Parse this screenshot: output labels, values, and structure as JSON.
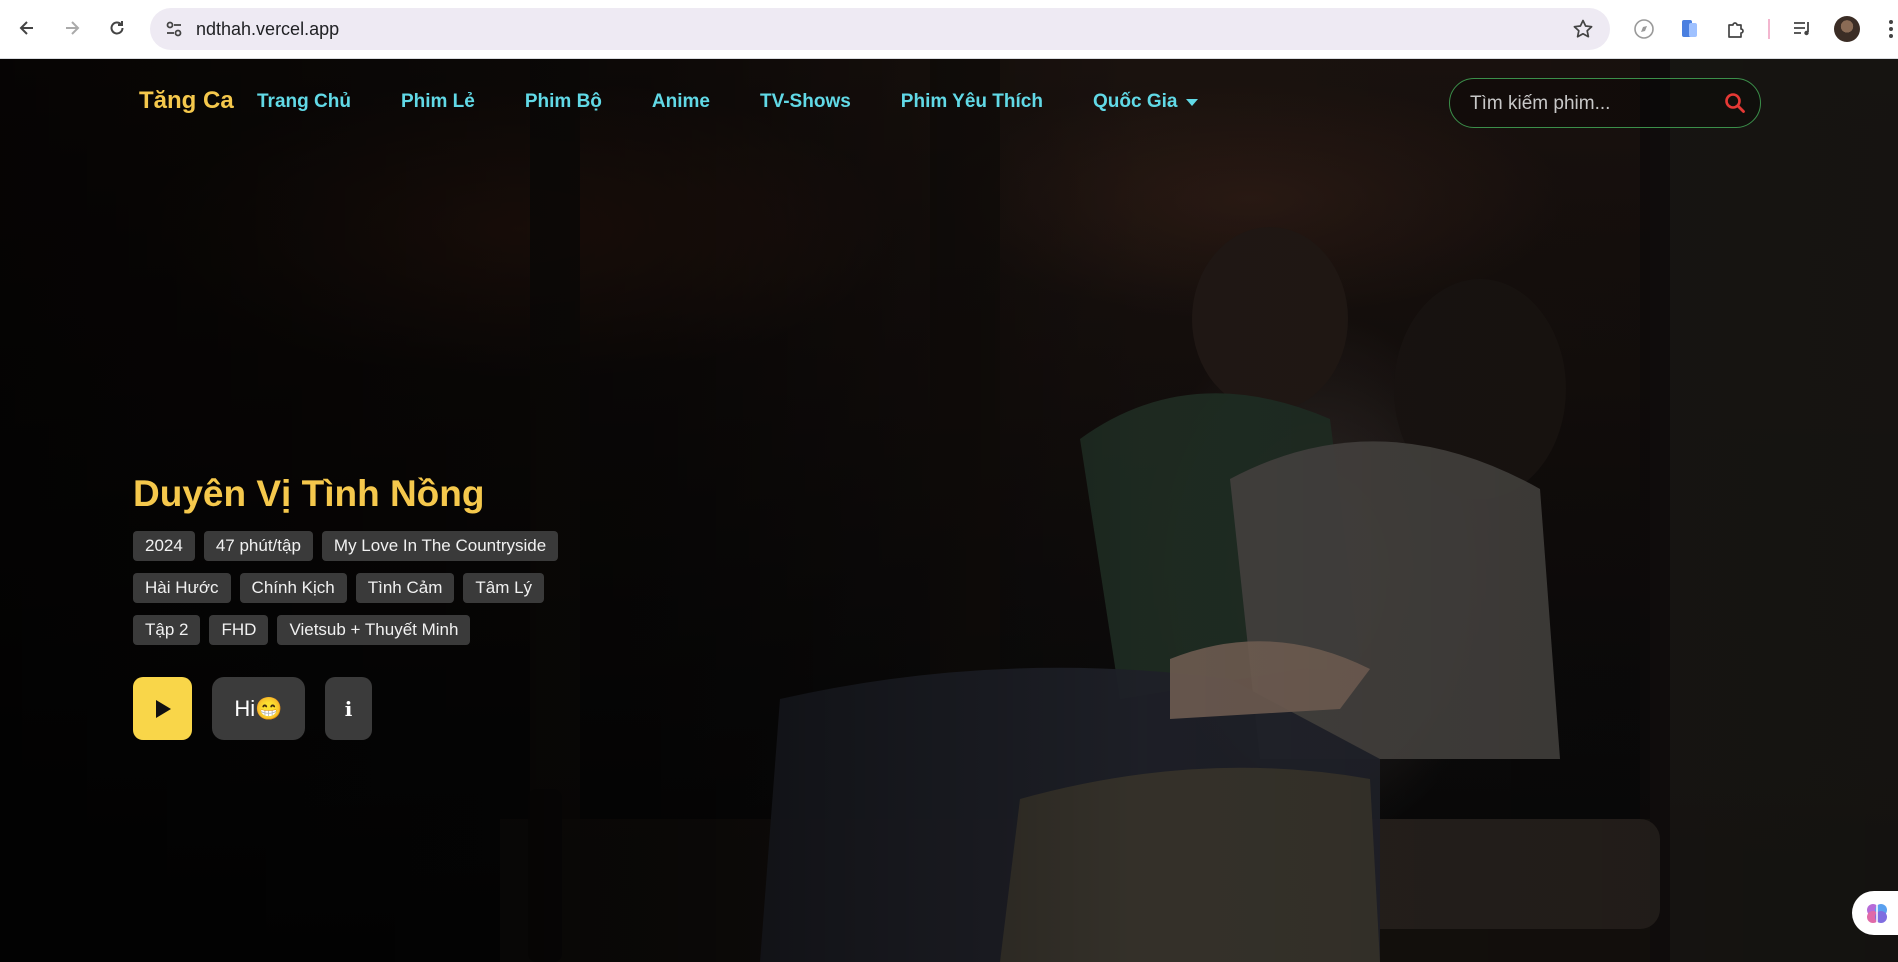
{
  "browser": {
    "url": "ndthah.vercel.app"
  },
  "site": {
    "logo": "Tăng Ca",
    "nav": [
      {
        "label": "Trang Chủ"
      },
      {
        "label": "Phim Lẻ"
      },
      {
        "label": "Phim Bộ"
      },
      {
        "label": "Anime"
      },
      {
        "label": "TV-Shows"
      },
      {
        "label": "Phim Yêu Thích"
      },
      {
        "label": "Quốc Gia"
      }
    ],
    "search": {
      "placeholder": "Tìm kiếm phim..."
    },
    "colors": {
      "accent": "#f5c84c",
      "nav": "#61d9e6",
      "play_button": "#f9d649",
      "search_icon": "#e53935"
    }
  },
  "hero": {
    "title": "Duyên Vị Tình Nồng",
    "meta": [
      "2024",
      "47 phút/tập",
      "My Love In The Countryside"
    ],
    "genres": [
      "Hài Hước",
      "Chính Kịch",
      "Tình Cảm",
      "Tâm Lý"
    ],
    "episode_info": [
      "Tập 2",
      "FHD",
      "Vietsub + Thuyết Minh"
    ],
    "buttons": {
      "play_icon": "play-icon",
      "hi_label": "Hi😁",
      "info_label": "i"
    }
  }
}
